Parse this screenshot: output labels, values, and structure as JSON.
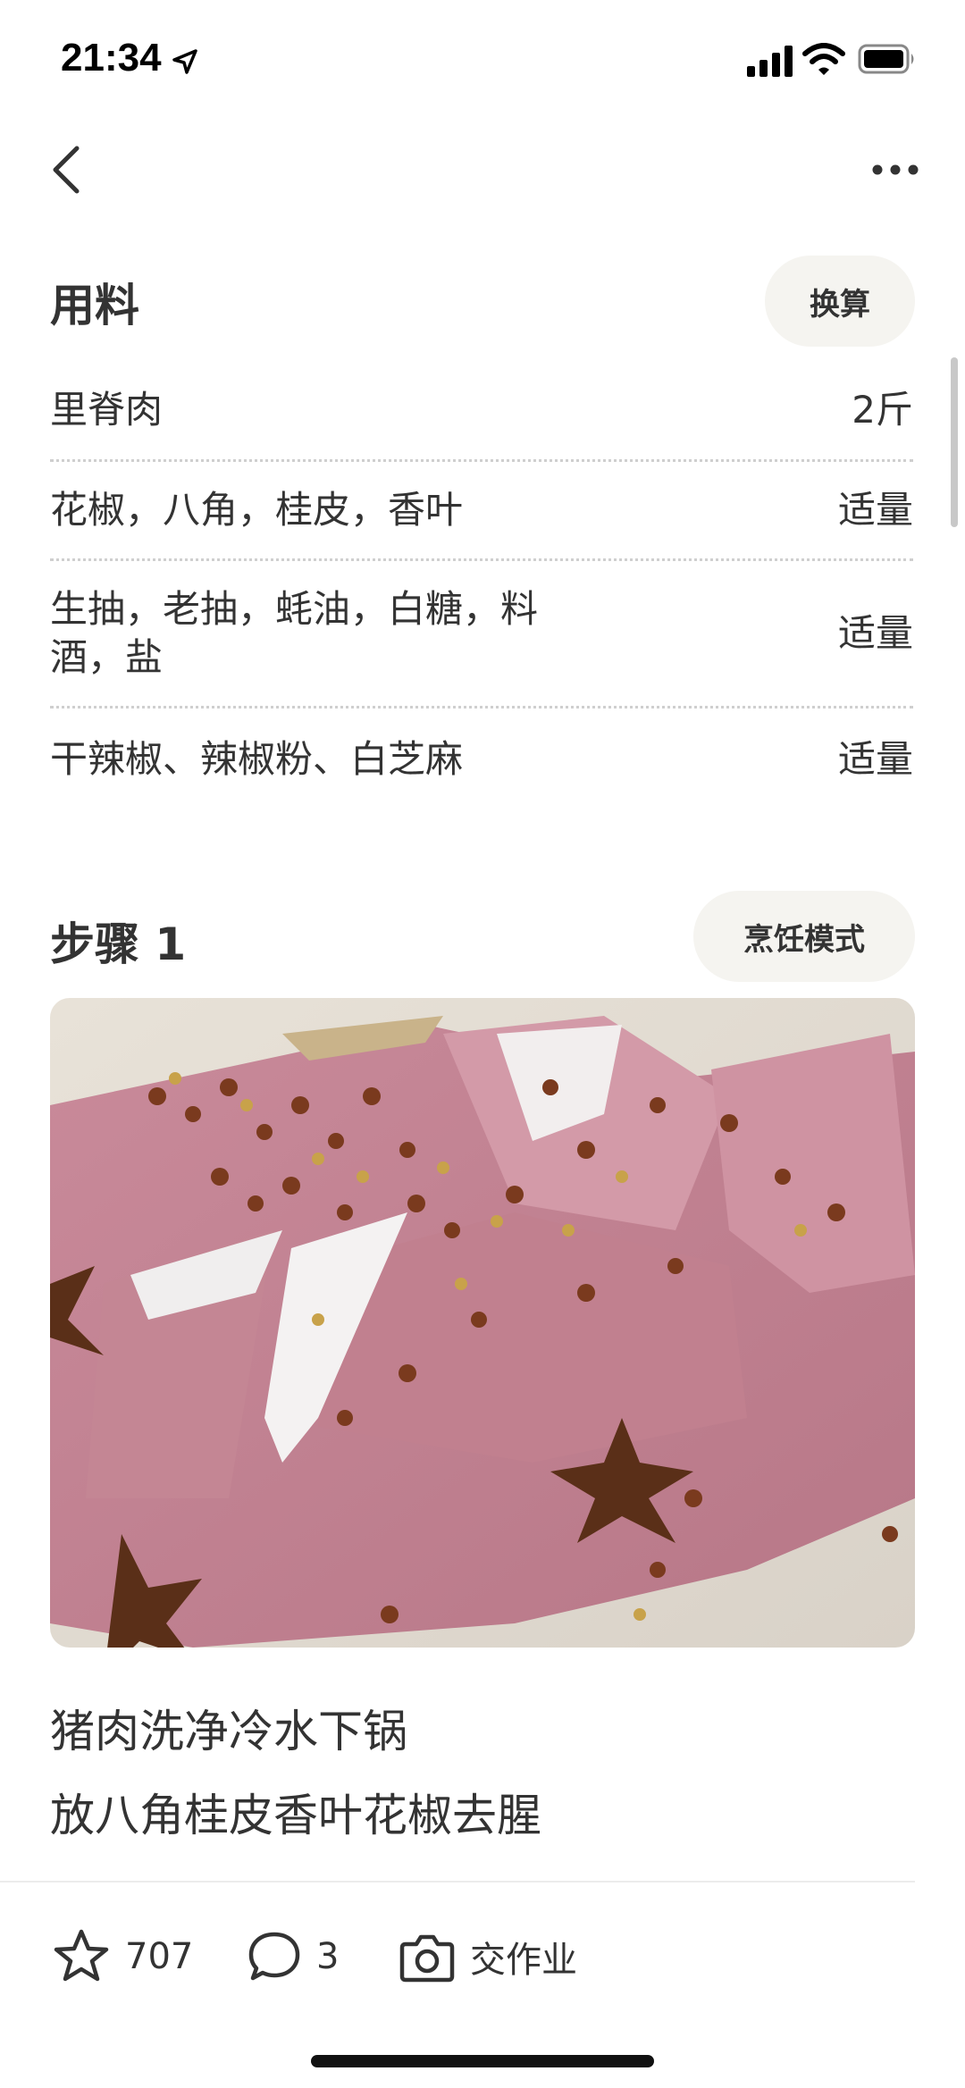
{
  "status_bar": {
    "time": "21:34"
  },
  "ingredients_section": {
    "title": "用料",
    "convert_label": "换算",
    "items": [
      {
        "name": "里脊肉",
        "qty": "2斤"
      },
      {
        "name": "花椒，八角，桂皮，香叶",
        "qty": "适量"
      },
      {
        "name": "生抽，老抽，蚝油，白糖，料酒，盐",
        "qty": "适量"
      },
      {
        "name": "干辣椒、辣椒粉、白芝麻",
        "qty": "适量"
      }
    ]
  },
  "step": {
    "title": "步骤 1",
    "cooking_mode_label": "烹饪模式",
    "lines": [
      "猪肉洗净冷水下锅",
      "放八角桂皮香叶花椒去腥"
    ]
  },
  "bottom_bar": {
    "favorite_count": "707",
    "comment_count": "3",
    "homework_label": "交作业"
  },
  "colors": {
    "text": "#333333",
    "pill_bg": "#f5f4f0",
    "divider": "#cfcfcf"
  }
}
